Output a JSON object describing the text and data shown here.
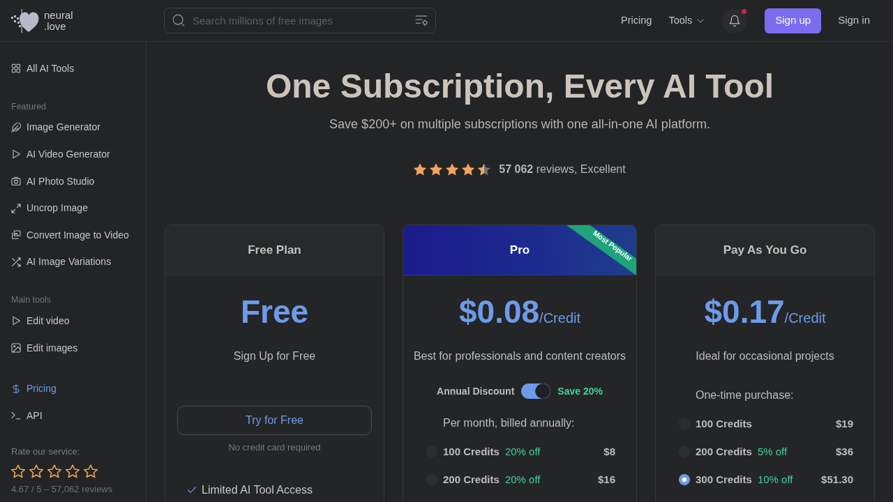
{
  "header": {
    "logo": {
      "line_1": "neural",
      "line_2": ".love"
    },
    "search": {
      "placeholder": "Search millions of free images"
    },
    "nav": [
      {
        "label": "Pricing",
        "kind": "link"
      },
      {
        "label": "Tools",
        "kind": "dropdown"
      }
    ],
    "notifications": {
      "unread": true
    },
    "buttons": [
      {
        "label": "Sign up",
        "kind": "primary"
      },
      {
        "label": "Sign in",
        "kind": "plain"
      }
    ]
  },
  "sidebar": {
    "groups": [
      {
        "items": [
          {
            "label": "All AI Tools",
            "selected": false
          }
        ]
      },
      {
        "heading": "Featured",
        "items": [
          {
            "label": "Image Generator",
            "selected": false
          },
          {
            "label": "AI Video Generator",
            "selected": false
          },
          {
            "label": "AI Photo Studio",
            "selected": false
          },
          {
            "label": "Uncrop Image",
            "selected": false
          },
          {
            "label": "Convert Image to Video",
            "selected": false
          },
          {
            "label": "AI Image Variations",
            "selected": false
          }
        ]
      },
      {
        "heading": "Main tools",
        "items": [
          {
            "label": "Edit video",
            "selected": false
          },
          {
            "label": "Edit images",
            "selected": false
          }
        ]
      },
      {
        "items": [
          {
            "label": "Pricing",
            "selected": true
          },
          {
            "label": "API",
            "selected": false
          }
        ]
      }
    ],
    "rating": {
      "label": "Rate our service:",
      "stars": 0,
      "summary": "4.67 / 5 – 57,062 reviews"
    }
  },
  "hero": {
    "title": "One Subscription, Every AI Tool",
    "subtitle": "Save $200+ on multiple subscriptions with one all-in-one AI platform.",
    "rating": {
      "stars": 4.5,
      "text": "**57 062** reviews, Excellent"
    }
  },
  "plans": [
    {
      "name": "Free Plan",
      "featured": false,
      "price": "Free",
      "description": "Sign Up for Free",
      "button": "Try for Free",
      "note": "No credit card required",
      "features": [
        "Limited AI Tool Access"
      ]
    },
    {
      "name": "Pro",
      "featured": true,
      "ribbon": "Most Popular",
      "price": "$0.08",
      "unit": "/Credit",
      "description": "Best for professionals and content creators",
      "toggle": {
        "label": "Annual Discount",
        "on": true,
        "note": "Save 20%"
      },
      "options_heading": "Per month, billed annually:",
      "options": [
        {
          "credits": "100 Credits",
          "discount": "20% off",
          "price": "$8",
          "selected": false
        },
        {
          "credits": "200 Credits",
          "discount": "20% off",
          "price": "$16",
          "selected": false
        }
      ]
    },
    {
      "name": "Pay As You Go",
      "featured": false,
      "price": "$0.17",
      "unit": "/Credit",
      "description": "Ideal for occasional projects",
      "options_heading": "One-time purchase:",
      "options": [
        {
          "credits": "100 Credits",
          "price": "$19",
          "selected": false
        },
        {
          "credits": "200 Credits",
          "discount": "5% off",
          "price": "$36",
          "selected": false
        },
        {
          "credits": "300 Credits",
          "discount": "10% off",
          "price": "$51.30",
          "selected": true
        }
      ]
    }
  ]
}
